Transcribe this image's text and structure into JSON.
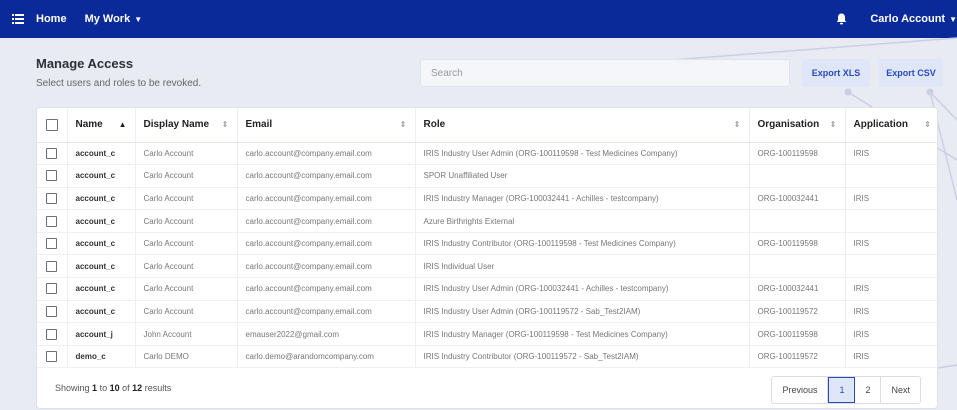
{
  "nav": {
    "home": "Home",
    "my_work": "My Work",
    "user": "Carlo Account"
  },
  "page": {
    "title": "Manage Access",
    "subtitle": "Select users and roles to be revoked."
  },
  "search": {
    "placeholder": "Search"
  },
  "actions": {
    "export_xls": "Export XLS",
    "export_csv": "Export CSV"
  },
  "table": {
    "headers": [
      "Name",
      "Display Name",
      "Email",
      "Role",
      "Organisation",
      "Application"
    ],
    "rows": [
      [
        "account_c",
        "Carlo Account",
        "carlo.account@company.email.com",
        "IRIS Industry User Admin (ORG-100119598 - Test Medicines Company)",
        "ORG-100119598",
        "IRIS"
      ],
      [
        "account_c",
        "Carlo Account",
        "carlo.account@company.email.com",
        "SPOR Unaffiliated User",
        "",
        ""
      ],
      [
        "account_c",
        "Carlo Account",
        "carlo.account@company.email.com",
        "IRIS Industry Manager (ORG-100032441 - Achilles - testcompany)",
        "ORG-100032441",
        "IRIS"
      ],
      [
        "account_c",
        "Carlo Account",
        "carlo.account@company.email.com",
        "Azure Birthrights External",
        "",
        ""
      ],
      [
        "account_c",
        "Carlo Account",
        "carlo.account@company.email.com",
        "IRIS Industry Contributor (ORG-100119598 - Test Medicines Company)",
        "ORG-100119598",
        "IRIS"
      ],
      [
        "account_c",
        "Carlo Account",
        "carlo.account@company.email.com",
        "IRIS Individual User",
        "",
        ""
      ],
      [
        "account_c",
        "Carlo Account",
        "carlo.account@company.email.com",
        "IRIS Industry User Admin (ORG-100032441 - Achilles - testcompany)",
        "ORG-100032441",
        "IRIS"
      ],
      [
        "account_c",
        "Carlo Account",
        "carlo.account@company.email.com",
        "IRIS Industry User Admin (ORG-100119572 - Sab_Test2IAM)",
        "ORG-100119572",
        "IRIS"
      ],
      [
        "account_j",
        "John Account",
        "emauser2022@gmail.com",
        "IRIS Industry Manager (ORG-100119598 - Test Medicines Company)",
        "ORG-100119598",
        "IRIS"
      ],
      [
        "demo_c",
        "Carlo DEMO",
        "carlo.demo@arandomcompany.com",
        "IRIS Industry Contributor (ORG-100119572 - Sab_Test2IAM)",
        "ORG-100119572",
        "IRIS"
      ]
    ]
  },
  "footer": {
    "showing": "Showing",
    "from": "1",
    "to_word": "to",
    "to": "10",
    "of_word": "of",
    "total": "12",
    "results": "results"
  },
  "pagination": {
    "previous": "Previous",
    "page1": "1",
    "page2": "2",
    "next": "Next"
  },
  "icons": {
    "menu": "menu-icon",
    "bell": "bell-icon"
  },
  "colors": {
    "topbar": "#0b2a9a",
    "accent": "#2a4bbd",
    "button_bg": "#dfe6f7"
  }
}
